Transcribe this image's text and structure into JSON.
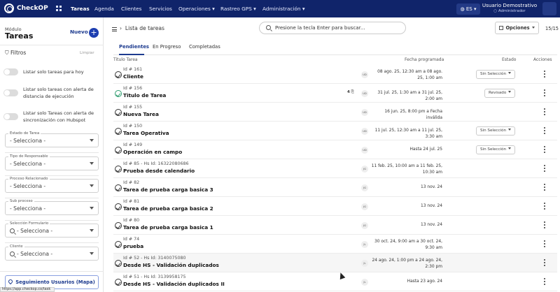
{
  "header": {
    "logo": "CheckOP",
    "nav": [
      "Tareas",
      "Agenda",
      "Clientes",
      "Servicios",
      "Operaciones",
      "Rastreo GPS",
      "Administración"
    ],
    "lang": "ES",
    "user_name": "Usuario Demostrativo",
    "user_role": "Administrador"
  },
  "sidebar": {
    "module": "Módulo",
    "title": "Tareas",
    "new": "Nuevo",
    "filters": "Filtros",
    "clear": "Limpiar",
    "toggles": [
      "Listar solo tareas para hoy",
      "Listar solo tareas con alerta de distancia de ejecución",
      "Listar solo Tareas con alerta de sincronización con Hubspot"
    ],
    "fields": [
      {
        "label": "Estado de Tarea",
        "value": "- Selecciona -"
      },
      {
        "label": "Tipo de Responsable",
        "value": "- Selecciona -"
      },
      {
        "label": "Proceso Relacionado",
        "value": "- Selecciona -"
      },
      {
        "label": "Sub proceso",
        "value": "- Selecciona -"
      },
      {
        "label": "Selección Formulario",
        "value": "- Selecciona -"
      },
      {
        "label": "Cliente",
        "value": "- Selecciona -"
      }
    ],
    "seguimiento": "Seguimiento Usuarios (Mapa)",
    "status_url": "https://app.checkop.co/task"
  },
  "main": {
    "breadcrumb": "Lista de tareas",
    "search_placeholder": "Presione la tecla Enter para buscar...",
    "options": "Opciones",
    "page": "15/15",
    "tabs": [
      "Pendientes",
      "En Progreso",
      "Completadas"
    ],
    "columns": {
      "title": "Titulo Tarea",
      "date": "Fecha programada",
      "status": "Estado",
      "actions": "Acciones"
    },
    "rows": [
      {
        "id": "Id # 161",
        "title": "Cliente",
        "avatar": "UD",
        "date": "08 ago. 25, 12:30 am a 08 ago. 25, 1:00 am",
        "status": "Sin Selección"
      },
      {
        "id": "Id # 156",
        "title": "Titulo de Tarea",
        "avatar": "UD",
        "count": "4",
        "date": "31 jul. 25, 1:30 am a 31 jul. 25, 2:00 am",
        "status": "Revisado"
      },
      {
        "id": "Id # 155",
        "title": "Nueva Tarea",
        "avatar": "UD",
        "date": "16 jun. 25, 8:00 pm a Fecha inválida",
        "status": ""
      },
      {
        "id": "Id # 150",
        "title": "Tarea Operativa",
        "avatar": "UD",
        "date": "11 jul. 25, 12:30 am a 11 jul. 25, 3:30 am",
        "status": "Sin Selección"
      },
      {
        "id": "Id # 149",
        "title": "Operación en campo",
        "avatar": "UD",
        "date": "Hasta 24 jul. 25",
        "status": "Sin Selección"
      },
      {
        "id": "Id # 85 - Hs Id: 16322080686",
        "title": "Prueba desde calendario",
        "avatar": "JG",
        "date": "11 feb. 25, 10:00 am a 11 feb. 25, 10:30 am",
        "status": ""
      },
      {
        "id": "Id # 82",
        "title": "Tarea de prueba carga basica 3",
        "avatar": "JG",
        "date": "13 nov. 24",
        "status": ""
      },
      {
        "id": "Id # 81",
        "title": "Tarea de prueba carga basica 2",
        "avatar": "JG",
        "date": "13 nov. 24",
        "status": ""
      },
      {
        "id": "Id # 80",
        "title": "Tarea de prueba carga basica 1",
        "avatar": "JG",
        "date": "13 nov. 24",
        "status": ""
      },
      {
        "id": "Id # 74",
        "title": "prueba",
        "avatar": "JL",
        "date": "30 oct. 24, 9:00 am a 30 oct. 24, 9:30 am",
        "status": ""
      },
      {
        "id": "Id # 52 - Hs Id: 3140075080",
        "title": "Desde HS - Validación duplicados",
        "avatar": "JL",
        "date": "24 ago. 24, 1:00 pm a 24 ago. 24, 2:30 pm",
        "status": ""
      },
      {
        "id": "Id # 51 - Hs Id: 3139958175",
        "title": "Desde HS - Validación duplicados II",
        "avatar": "JL",
        "date": "Hasta 23 ago. 24",
        "status": ""
      }
    ]
  }
}
